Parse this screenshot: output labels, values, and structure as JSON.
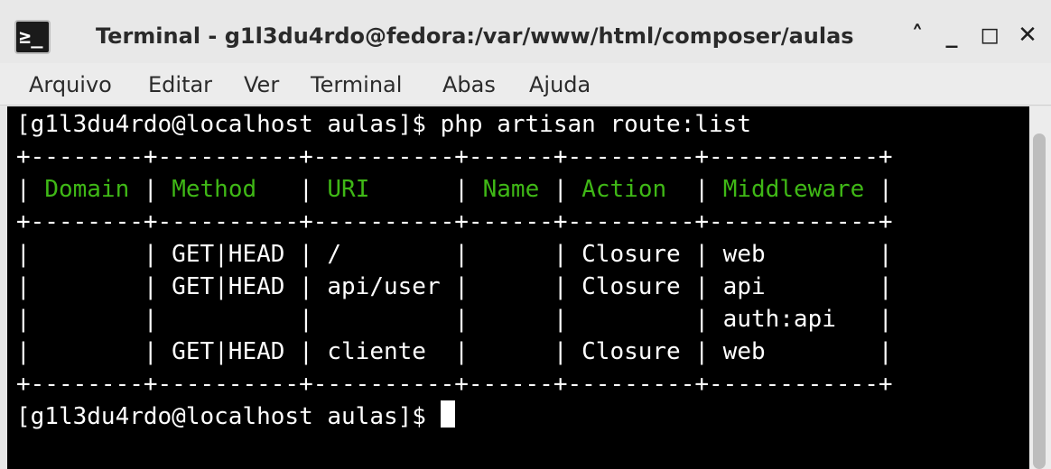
{
  "window": {
    "title": "Terminal - g1l3du4rdo@fedora:/var/www/html/composer/aulas",
    "icon_glyph": "≥_",
    "buttons": {
      "chevron_up": "˄",
      "minimize": "_",
      "maximize": "◻",
      "close": "✕"
    }
  },
  "menu": [
    "Arquivo",
    "Editar",
    "Ver",
    "Terminal",
    "Abas",
    "Ajuda"
  ],
  "terminal": {
    "command_line": "[g1l3du4rdo@localhost aulas]$ php artisan route:list",
    "table_border": "+--------+----------+----------+------+---------+------------+",
    "header_cells": [
      "Domain",
      "Method",
      "URI",
      "Name",
      "Action",
      "Middleware"
    ],
    "header_row": {
      "c0": "| ",
      "domain": "Domain",
      "c1": " | ",
      "method": "Method",
      "c2": "   | ",
      "uri": "URI",
      "c3": "      | ",
      "name": "Name",
      "c4": " | ",
      "action": "Action",
      "c5": "  | ",
      "middleware": "Middleware",
      "c6": " |"
    },
    "rows": [
      "|        | GET|HEAD | /        |      | Closure | web        |",
      "|        | GET|HEAD | api/user |      | Closure | api        |",
      "|        |          |          |      |         | auth:api   |",
      "|        | GET|HEAD | cliente  |      | Closure | web        |"
    ],
    "prompt": "[g1l3du4rdo@localhost aulas]$ "
  },
  "colors": {
    "terminal_background": "#000000",
    "terminal_text": "#ffffff",
    "header_text": "#3fb816"
  }
}
